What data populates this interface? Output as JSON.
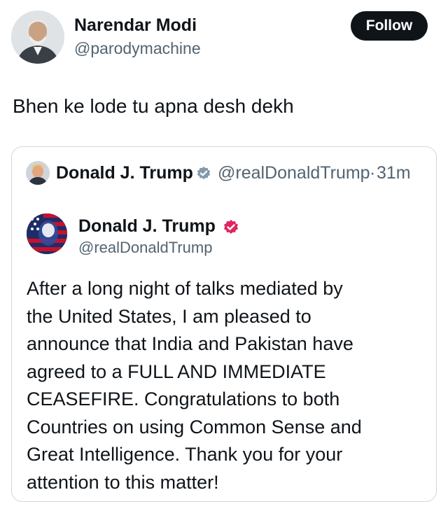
{
  "author": {
    "name": "Narendar Modi",
    "handle": "@parodymachine",
    "follow_label": "Follow"
  },
  "tweet_text": "Bhen ke lode tu apna desh dekh",
  "quote": {
    "name": "Donald J. Trump",
    "handle": "@realDonaldTrump",
    "separator": "·",
    "time": "31m",
    "embedded_post": {
      "name": "Donald J. Trump",
      "handle": "@realDonaldTrump",
      "body_lines": [
        "After a long night of talks mediated by",
        "the United States, I am pleased to",
        "announce that India and Pakistan have",
        "agreed to a FULL AND IMMEDIATE",
        "CEASEFIRE. Congratulations to both",
        "Countries on using Common Sense and",
        "Great Intelligence. Thank you for your",
        "attention to this matter!"
      ]
    }
  },
  "colors": {
    "text": "#0f1419",
    "secondary": "#536471",
    "border": "#cfd9de",
    "follow_bg": "#0f1419",
    "verified_gray": "#829aab",
    "verified_pink": "#e0245e"
  }
}
